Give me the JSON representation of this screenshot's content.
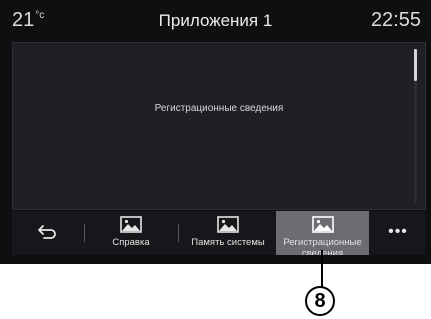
{
  "status": {
    "temperature": "21",
    "temperature_unit": "°c",
    "title": "Приложения 1",
    "time": "22:55"
  },
  "content": {
    "text": "Регистрационные сведения"
  },
  "bottom_bar": {
    "tabs": [
      {
        "label": "Справка",
        "icon": "image-icon"
      },
      {
        "label": "Память системы",
        "icon": "image-icon"
      },
      {
        "label": "Регистрационные сведения",
        "icon": "image-icon",
        "active": true
      }
    ],
    "more_label": "•••"
  },
  "callout": {
    "number": "8"
  }
}
